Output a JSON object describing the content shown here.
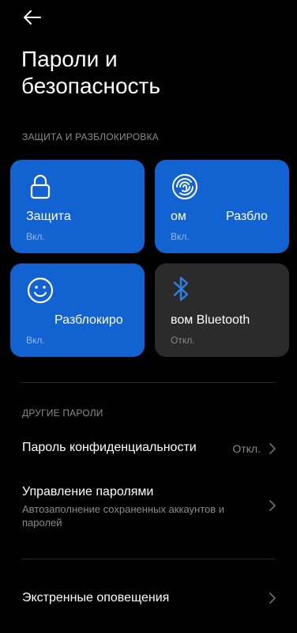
{
  "header": {
    "back_icon": "arrow-left-icon",
    "title_line1": "Пароли и",
    "title_line2": "безопасность"
  },
  "section_lock": {
    "label": "ЗАЩИТА И РАЗБЛОКИРОВКА"
  },
  "tiles": [
    {
      "name": "Защита",
      "state": "Вкл.",
      "icon": "lock-icon",
      "active": true
    },
    {
      "name_part1": "ом",
      "name_part2": "Разбло",
      "state": "Вкл.",
      "icon": "fingerprint-icon",
      "active": true
    },
    {
      "name": "Разблокиро",
      "state": "Вкл.",
      "icon": "face-icon",
      "active": true
    },
    {
      "name": "вом Bluetooth",
      "state": "Откл.",
      "icon": "bluetooth-icon",
      "active": false
    }
  ],
  "section_other": {
    "label": "ДРУГИЕ ПАРОЛИ"
  },
  "rows": {
    "privacy": {
      "label": "Пароль конфиденциальности",
      "value": "Откл."
    },
    "manager": {
      "label": "Управление паролями",
      "sub": "Автозаполнение сохраненных аккаунтов и паролей"
    },
    "emergency": {
      "label": "Экстренные оповещения"
    }
  },
  "colors": {
    "accent": "#1362d2",
    "tile_off": "#2b2b2b",
    "bluetooth_icon": "#2f7de8"
  }
}
